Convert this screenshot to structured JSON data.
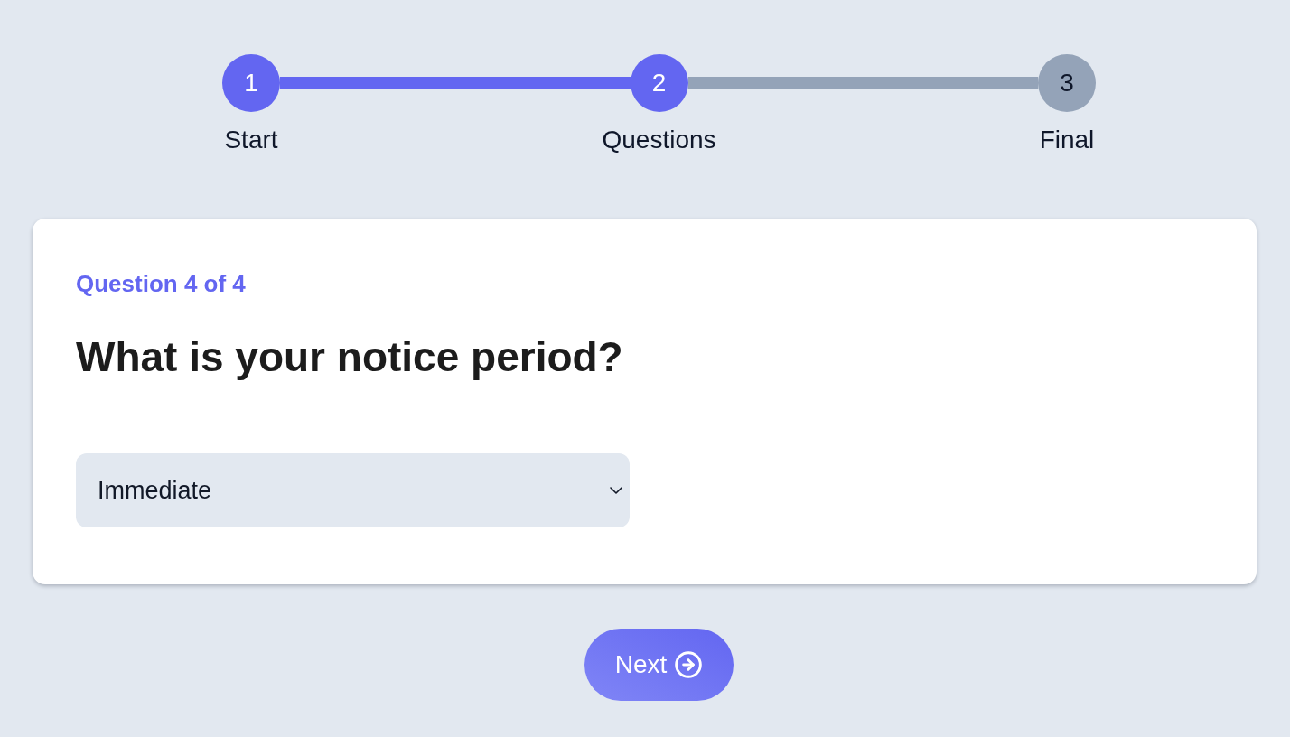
{
  "stepper": {
    "steps": [
      {
        "number": "1",
        "label": "Start",
        "reached": true
      },
      {
        "number": "2",
        "label": "Questions",
        "reached": true
      },
      {
        "number": "3",
        "label": "Final",
        "reached": false
      }
    ]
  },
  "card": {
    "counter": "Question 4 of 4",
    "question": "What is your notice period?",
    "select": {
      "value": "Immediate"
    }
  },
  "next_button": {
    "label": "Next"
  }
}
